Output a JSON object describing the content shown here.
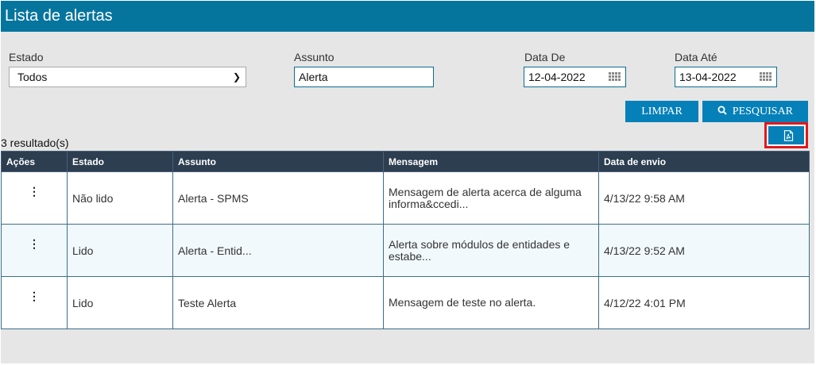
{
  "header": {
    "title": "Lista de alertas"
  },
  "filters": {
    "estado_label": "Estado",
    "estado_value": "Todos",
    "assunto_label": "Assunto",
    "assunto_value": "Alerta",
    "data_de_label": "Data De",
    "data_de_value": "12-04-2022",
    "data_ate_label": "Data Até",
    "data_ate_value": "13-04-2022"
  },
  "buttons": {
    "limpar": "LIMPAR",
    "pesquisar": "PESQUISAR"
  },
  "icons": {
    "search": "search-icon",
    "calendar": "calendar-icon",
    "pdf": "pdf-icon",
    "actions": "kebab-menu-icon"
  },
  "results": {
    "count_text": "3 resultado(s)"
  },
  "table": {
    "headers": [
      "Ações",
      "Estado",
      "Assunto",
      "Mensagem",
      "Data de envio"
    ],
    "rows": [
      {
        "action": "⋮",
        "estado": "Não lido",
        "assunto": "Alerta - SPMS",
        "mensagem": "Mensagem de alerta acerca de alguma informa&ccedi...",
        "data": "4/13/22 9:58 AM"
      },
      {
        "action": "⋮",
        "estado": "Lido",
        "assunto": "Alerta - Entid...",
        "mensagem": "Alerta sobre módulos de entidades e estabe...",
        "data": "4/13/22 9:52 AM"
      },
      {
        "action": "⋮",
        "estado": "Lido",
        "assunto": "Teste Alerta",
        "mensagem": "Mensagem de teste no alerta.",
        "data": "4/12/22 4:01 PM"
      }
    ]
  },
  "colors": {
    "header_bg": "#06759e",
    "button_bg": "#0580b8",
    "table_head_bg": "#2c3e50",
    "highlight": "#e0191d"
  }
}
